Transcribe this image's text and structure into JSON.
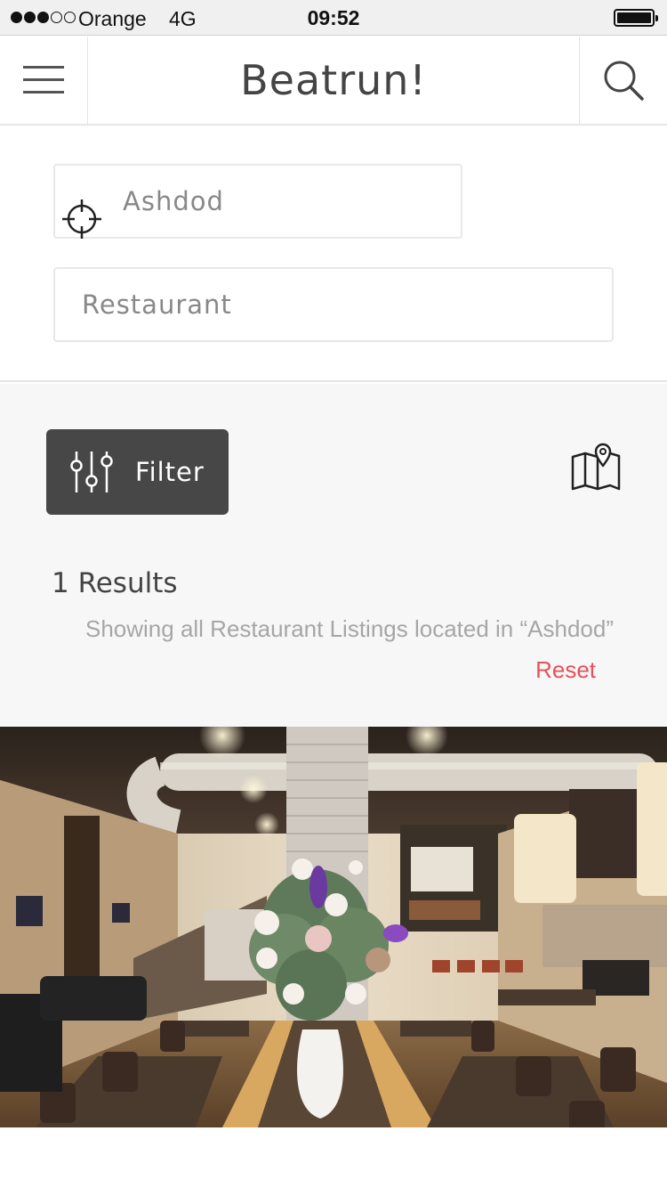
{
  "status_bar": {
    "carrier": "Orange",
    "network": "4G",
    "time": "09:52",
    "signal_bars_filled": 3,
    "signal_bars_total": 5,
    "battery_level": 1.0
  },
  "header": {
    "title": "Beatrun!",
    "menu_icon": "hamburger-menu-icon",
    "search_icon": "search-icon"
  },
  "search": {
    "location_value": "Ashdod",
    "location_icon": "crosshair-icon",
    "category_value": "Restaurant"
  },
  "filters": {
    "filter_label": "Filter",
    "filter_icon": "sliders-icon",
    "map_icon": "map-pin-icon"
  },
  "results": {
    "count_label": "1 Results",
    "description": "Showing all Restaurant Listings located in “Ashdod”",
    "reset_label": "Reset"
  },
  "colors": {
    "accent": "#e8505b",
    "filter_button": "#474747",
    "panel_background": "#f7f7f7"
  }
}
